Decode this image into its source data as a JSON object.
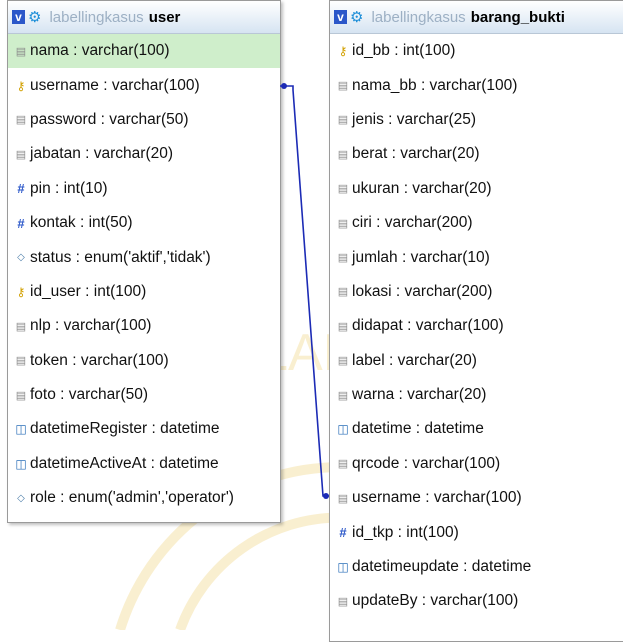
{
  "watermark": {
    "text": "ISLAM"
  },
  "tables": [
    {
      "db": "labellingkasus",
      "name": "user",
      "columns": [
        {
          "icon": "text",
          "text": "nama : varchar(100)",
          "selected": true
        },
        {
          "icon": "key",
          "text": "username : varchar(100)"
        },
        {
          "icon": "text",
          "text": "password : varchar(50)"
        },
        {
          "icon": "text",
          "text": "jabatan : varchar(20)"
        },
        {
          "icon": "num",
          "text": "pin : int(10)"
        },
        {
          "icon": "num",
          "text": "kontak : int(50)"
        },
        {
          "icon": "enum",
          "text": "status : enum('aktif','tidak')"
        },
        {
          "icon": "key",
          "text": "id_user : int(100)"
        },
        {
          "icon": "text",
          "text": "nlp : varchar(100)"
        },
        {
          "icon": "text",
          "text": "token : varchar(100)"
        },
        {
          "icon": "text",
          "text": "foto : varchar(50)"
        },
        {
          "icon": "date",
          "text": "datetimeRegister : datetime"
        },
        {
          "icon": "date",
          "text": "datetimeActiveAt : datetime"
        },
        {
          "icon": "enum",
          "text": "role : enum('admin','operator')"
        }
      ]
    },
    {
      "db": "labellingkasus",
      "name": "barang_bukti",
      "columns": [
        {
          "icon": "key",
          "text": "id_bb : int(100)"
        },
        {
          "icon": "text",
          "text": "nama_bb : varchar(100)"
        },
        {
          "icon": "text",
          "text": "jenis : varchar(25)"
        },
        {
          "icon": "text",
          "text": "berat : varchar(20)"
        },
        {
          "icon": "text",
          "text": "ukuran : varchar(20)"
        },
        {
          "icon": "text",
          "text": "ciri : varchar(200)"
        },
        {
          "icon": "text",
          "text": "jumlah : varchar(10)"
        },
        {
          "icon": "text",
          "text": "lokasi : varchar(200)"
        },
        {
          "icon": "text",
          "text": "didapat : varchar(100)"
        },
        {
          "icon": "text",
          "text": "label : varchar(20)"
        },
        {
          "icon": "text",
          "text": "warna : varchar(20)"
        },
        {
          "icon": "date",
          "text": "datetime : datetime"
        },
        {
          "icon": "text",
          "text": "qrcode : varchar(100)"
        },
        {
          "icon": "text",
          "text": "username : varchar(100)"
        },
        {
          "icon": "num",
          "text": "id_tkp : int(100)"
        },
        {
          "icon": "date",
          "text": "datetimeupdate : datetime"
        },
        {
          "icon": "text",
          "text": "updateBy : varchar(100)"
        }
      ]
    }
  ],
  "relation": {
    "from": "user.username",
    "to": "barang_bukti.username",
    "color": "#1c2bb5"
  }
}
